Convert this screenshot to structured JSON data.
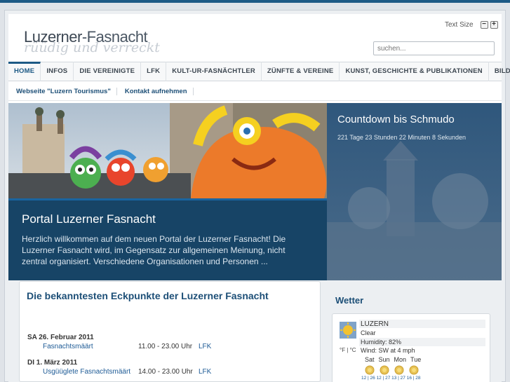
{
  "header": {
    "logo_main": "Luzerner",
    "logo_dash": "-Fasnacht",
    "logo_tagline": "rüüdig und verreckt",
    "text_size_label": "Text Size",
    "text_size_minus": "−",
    "text_size_plus": "+",
    "search_placeholder": "suchen..."
  },
  "nav": {
    "items": [
      {
        "label": "HOME"
      },
      {
        "label": "INFOS"
      },
      {
        "label": "DIE VEREINIGTE"
      },
      {
        "label": "LFK"
      },
      {
        "label": "KULT-UR-FASNÄCHTLER"
      },
      {
        "label": "ZÜNFTE & VEREINE"
      },
      {
        "label": "KUNST, GESCHICHTE & PUBLIKATIONEN"
      },
      {
        "label": "BILDER"
      }
    ]
  },
  "subnav": {
    "items": [
      {
        "label": "Webseite \"Luzern Tourismus\""
      },
      {
        "label": "Kontakt aufnehmen"
      }
    ]
  },
  "hero": {
    "title": "Portal Luzerner Fasnacht",
    "text": "Herzlich willkommen auf dem neuen Portal der Luzerner Fasnacht! Die Luzerner Fasnacht wird, im Gegensatz zur allgemeinen Meinung, nicht zentral organisiert. Verschiedene Organisationen und Personen ..."
  },
  "countdown": {
    "title": "Countdown bis Schmudo",
    "text": "221 Tage 23 Stunden 22 Minuten 8 Sekunden"
  },
  "events": {
    "title": "Die bekanntesten Eckpunkte der Luzerner Fasnacht",
    "items": [
      {
        "date": "SA 26. Februar 2011",
        "name": "Fasnachtsmäärt",
        "time": "11.00 - 23.00 Uhr",
        "org": "LFK"
      },
      {
        "date": "DI 1. März 2011",
        "name": "Usgüüglete Fasnachtsmäärt",
        "time": "14.00 - 23.00 Uhr",
        "org": "LFK"
      }
    ]
  },
  "weather": {
    "title": "Wetter",
    "city": "LUZERN",
    "condition": "Clear",
    "humidity": "Humidity: 82%",
    "wind": "Wind: SW at 4 mph",
    "units": "°F | °C",
    "days": [
      "Sat",
      "Sun",
      "Mon",
      "Tue"
    ],
    "temps": "12 | 26 12 | 27 13 | 27 16 | 28",
    "icon": "sun-icon",
    "colors": {
      "sun": "#f2c230",
      "accent": "#1d5a85"
    }
  }
}
